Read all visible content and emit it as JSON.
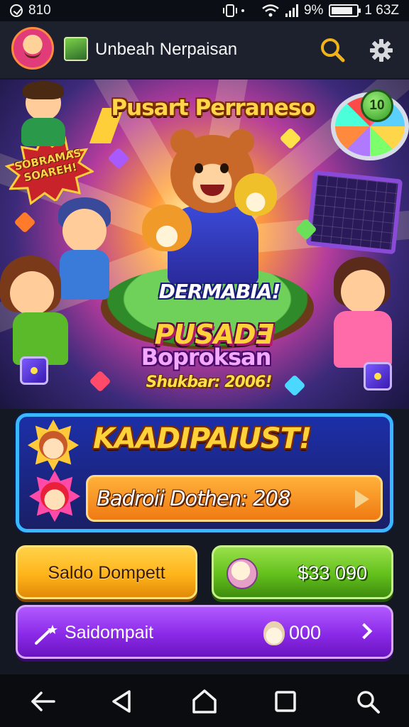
{
  "status_bar": {
    "time": "810",
    "battery_percent": "9%",
    "clock_right": "1 63Z",
    "battery_level": 0.85
  },
  "header": {
    "title": "Unbeah Nerpaisan",
    "avatar_icon": "mascot-avatar",
    "app_icon": "app-logo",
    "search_icon": "search-icon",
    "settings_icon": "gear-icon"
  },
  "banner": {
    "headline": "Pusart Perraneso",
    "sticker": "SOBRAMAS SOAREH!",
    "badge": "10",
    "title_line1": "PUSADƎ",
    "title_line2": "DERMABIA!",
    "promo": "Boproksan",
    "subtitle": "Shukbar: 2006!"
  },
  "promo_card": {
    "title": "KAADIPAIUST!",
    "bar_label": "Badroii Dothen: 208",
    "arrow_icon": "play-arrow-icon"
  },
  "buttons": {
    "saldo_label": "Saldo Dompett",
    "balance_value": "$33 090",
    "balance_icon": "coin-mascot-icon",
    "wallet_label": "Saidompait",
    "wallet_count": "000",
    "wallet_icon": "magic-wand-icon",
    "bag_icon": "money-bag-icon",
    "chevron_icon": "chevron-right-icon"
  },
  "nav": {
    "back_icon": "back-arrow-icon",
    "home_triangle_icon": "triangle-back-icon",
    "home_icon": "home-icon",
    "recents_icon": "square-recents-icon",
    "search_icon": "search-icon"
  },
  "colors": {
    "yellow_button": "#ffb41a",
    "green_button": "#62c01c",
    "purple_button": "#8a2ae8",
    "promo_border": "#3ab8ff",
    "accent_orange": "#f07a12"
  }
}
